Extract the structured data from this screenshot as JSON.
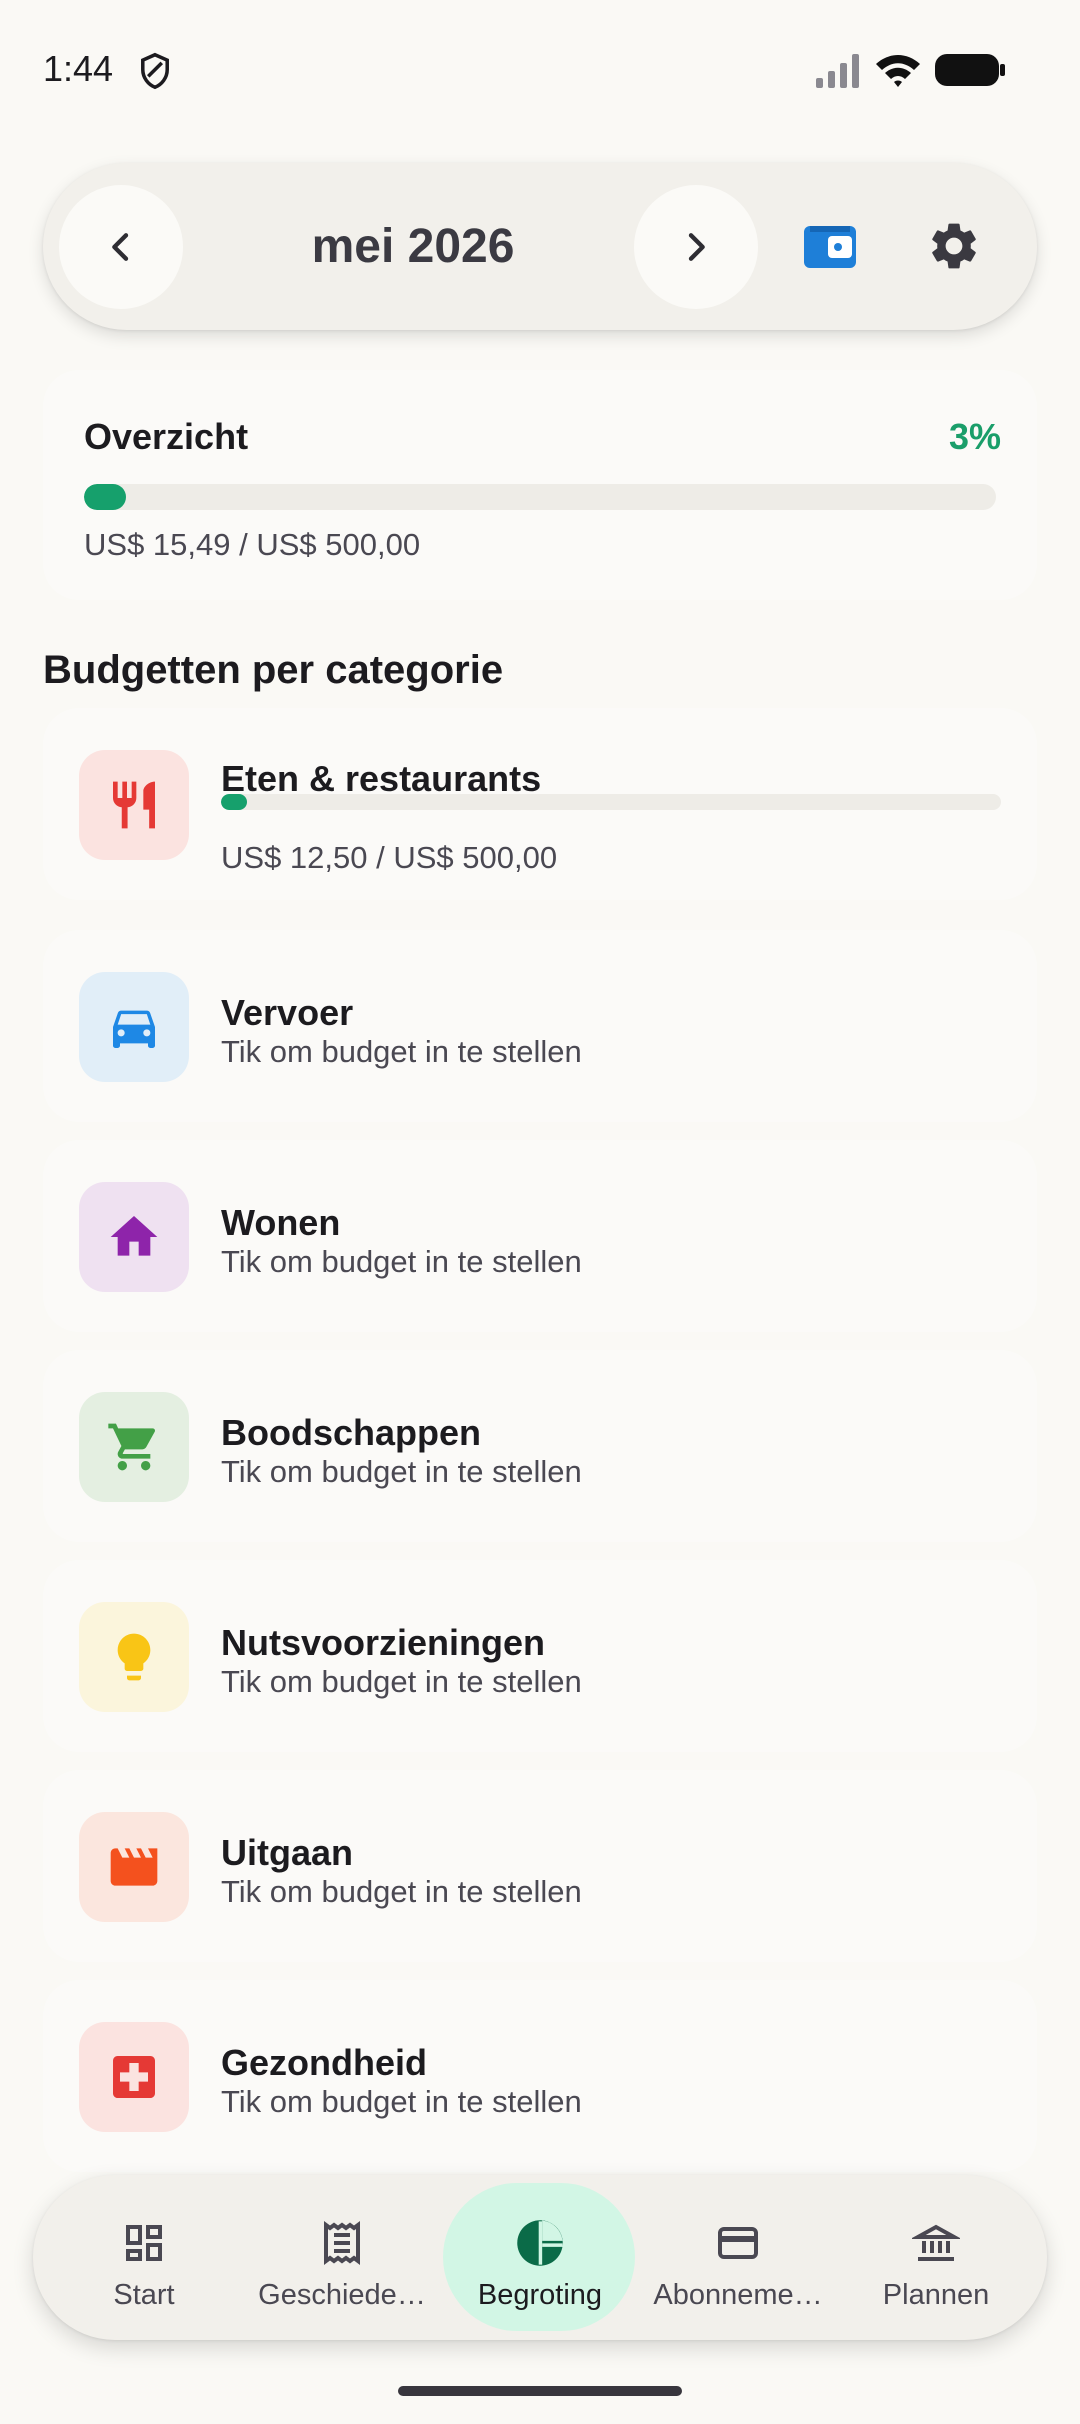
{
  "status_bar": {
    "time": "1:44"
  },
  "header": {
    "month": "mei 2026",
    "icons": {
      "prev": "chevron-left-icon",
      "next": "chevron-right-icon",
      "wallet": "wallet-icon",
      "settings": "gear-icon"
    },
    "wallet_color": "#1E7FD8"
  },
  "overview": {
    "title": "Overzicht",
    "percent_label": "3%",
    "progress": 0.03,
    "amount": "US$ 15,49 / US$ 500,00",
    "accent_color": "#16A06C"
  },
  "section_title": "Budgetten per categorie",
  "categories": [
    {
      "name": "Eten & restaurants",
      "amount": "US$ 12,50 / US$ 500,00",
      "progress": 0.025,
      "icon": "utensils-icon",
      "icon_color": "#E53935",
      "bg_color": "#FBE3E0"
    },
    {
      "name": "Vervoer",
      "subtitle": "Tik om budget in te stellen",
      "icon": "car-icon",
      "icon_color": "#1E88E5",
      "bg_color": "#E1EEF8"
    },
    {
      "name": "Wonen",
      "subtitle": "Tik om budget in te stellen",
      "icon": "home-icon",
      "icon_color": "#8E24AA",
      "bg_color": "#EFE1F1"
    },
    {
      "name": "Boodschappen",
      "subtitle": "Tik om budget in te stellen",
      "icon": "cart-icon",
      "icon_color": "#43A047",
      "bg_color": "#E4EFE1"
    },
    {
      "name": "Nutsvoorzieningen",
      "subtitle": "Tik om budget in te stellen",
      "icon": "lightbulb-icon",
      "icon_color": "#F9C516",
      "bg_color": "#FBF5DC"
    },
    {
      "name": "Uitgaan",
      "subtitle": "Tik om budget in te stellen",
      "icon": "clapperboard-icon",
      "icon_color": "#F4511E",
      "bg_color": "#FBE6DE"
    },
    {
      "name": "Gezondheid",
      "subtitle": "Tik om budget in te stellen",
      "icon": "medical-cross-icon",
      "icon_color": "#E53935",
      "bg_color": "#FBE3E0"
    }
  ],
  "bottom_nav": {
    "items": [
      {
        "label": "Start",
        "icon": "dashboard-icon"
      },
      {
        "label": "Geschiede…",
        "icon": "receipt-icon"
      },
      {
        "label": "Begroting",
        "icon": "pie-chart-icon",
        "active": true
      },
      {
        "label": "Abonneme…",
        "icon": "credit-card-icon"
      },
      {
        "label": "Plannen",
        "icon": "bank-icon"
      }
    ],
    "active_color": "#D2F6E5"
  }
}
